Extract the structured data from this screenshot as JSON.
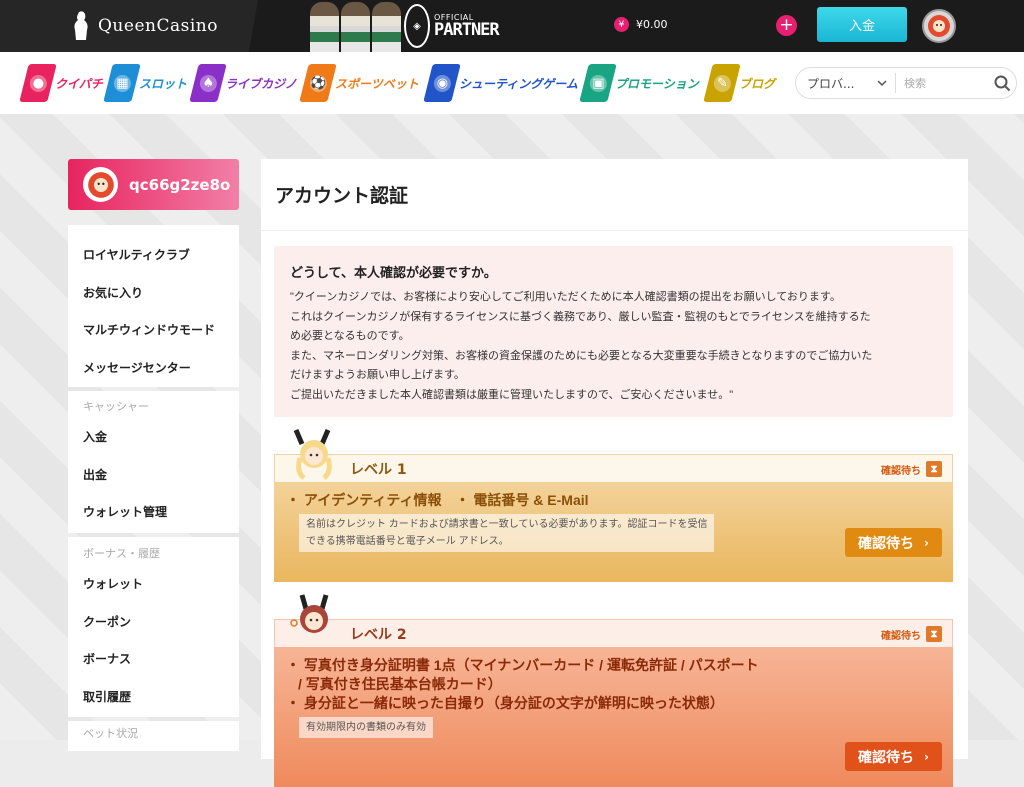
{
  "header": {
    "logo_text": "QueenCasino",
    "partner_small": "OFFICIAL",
    "partner_big": "PARTNER",
    "balance_symbol": "¥",
    "balance": "¥0.00",
    "plus_label": "+",
    "deposit_label": "入金"
  },
  "nav": {
    "items": [
      {
        "label": "クイパチ",
        "color": "#e8235f",
        "icon": "quipachi-icon"
      },
      {
        "label": "スロット",
        "color": "#1e8fd6",
        "icon": "slot-icon"
      },
      {
        "label": "ライブカジノ",
        "color": "#8b2fc9",
        "icon": "live-casino-icon"
      },
      {
        "label": "スポーツベット",
        "color": "#f07a17",
        "icon": "sports-icon"
      },
      {
        "label": "シューティングゲーム",
        "color": "#2154c9",
        "icon": "shooting-icon"
      },
      {
        "label": "プロモーション",
        "color": "#19a583",
        "icon": "gift-icon"
      },
      {
        "label": "ブログ",
        "color": "#c9a400",
        "icon": "blog-icon"
      }
    ],
    "provider_placeholder": "プロバ...",
    "search_placeholder": "検索"
  },
  "sidebar": {
    "username": "qc66g2ze8o",
    "group1": [
      "ロイヤルティクラブ",
      "お気に入り",
      "マルチウィンドウモード",
      "メッセージセンター"
    ],
    "cashier_head": "キャッシャー",
    "group2": [
      "入金",
      "出金",
      "ウォレット管理"
    ],
    "bonus_head": "ボーナス・履歴",
    "group3": [
      "ウォレット",
      "クーポン",
      "ボーナス",
      "取引履歴"
    ],
    "bet_head": "ベット状況"
  },
  "main": {
    "title": "アカウント認証",
    "why_title": "どうして、本人確認が必要ですか。",
    "why_lines": [
      "\"クイーンカジノでは、お客様により安心してご利用いただくために本人確認書類の提出をお願いしております。",
      "これはクイーンカジノが保有するライセンスに基づく義務であり、厳しい監査・監視のもとでライセンスを維持するた",
      "め必要となるものです。",
      "また、マネーロンダリング対策、お客様の資金保護のためにも必要となる大変重要な手続きとなりますのでご協力いた",
      "だけますようお願い申し上げます。",
      "ご提出いただきました本人確認書類は厳重に管理いたしますので、ご安心くださいませ。\""
    ],
    "levels": [
      {
        "title": "レベル 1",
        "status": "確認待ち",
        "items": [
          "アイデンティティ情報　・ 電話番号 & E-Mail"
        ],
        "note_lines": [
          "名前はクレジット カードおよび請求書と一致している必要があります。認証コードを受信",
          "できる携帯電話番号と電子メール アドレス。"
        ],
        "button": "確認待ち"
      },
      {
        "title": "レベル 2",
        "status": "確認待ち",
        "items": [
          "写真付き身分証明書 1点（マイナンバーカード / 運転免許証 / パスポート",
          "/ 写真付き住民基本台帳カード）",
          "身分証と一緒に映った自撮り（身分証の文字が鮮明に映った状態）"
        ],
        "note_lines": [
          "有効期限内の書類のみ有効"
        ],
        "button": "確認待ち"
      }
    ]
  },
  "colors": {
    "pink": "#e8235f",
    "cyan": "#25c4e0",
    "level1": "#e0a84a",
    "level2": "#ef8a5c"
  }
}
